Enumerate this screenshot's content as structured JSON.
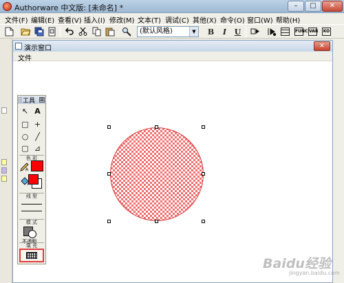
{
  "app": {
    "title": "Authorware 中文版: [未命名] *",
    "caption_buttons": {
      "minimize": "–",
      "maximize": "□",
      "close": "✕"
    }
  },
  "menubar": {
    "items": [
      {
        "label": "文件(F)"
      },
      {
        "label": "编辑(E)"
      },
      {
        "label": "查看(V)"
      },
      {
        "label": "插入(I)"
      },
      {
        "label": "修改(M)"
      },
      {
        "label": "文本(T)"
      },
      {
        "label": "调试(C)"
      },
      {
        "label": "其他(X)"
      },
      {
        "label": "命令(O)"
      },
      {
        "label": "窗口(W)"
      },
      {
        "label": "帮助(H)"
      }
    ]
  },
  "toolbar": {
    "style_select": {
      "value": "(默认风格)",
      "arrow": "▼"
    },
    "bold": "B",
    "italic": "I",
    "underline": "U",
    "icons": [
      "new-icon",
      "open-icon",
      "save-all-icon",
      "import-icon",
      "undo-icon",
      "cut-icon",
      "copy-icon",
      "paste-icon",
      "find-icon",
      "run-icon",
      "restart-icon",
      "control-panel-icon",
      "functions-icon",
      "variables-icon",
      "knowledge-objects-icon"
    ],
    "box_icons": {
      "functions": "FUNC",
      "variables": "VAR",
      "knowledge": "KO"
    }
  },
  "presentation_window": {
    "title": "演示窗口",
    "menu_file": "文件",
    "close": "✕"
  },
  "tools_palette": {
    "title": "工具",
    "close": "⊠",
    "tools": {
      "pointer": "↖",
      "text": "A",
      "rectangle": "□",
      "crosshair": "+",
      "ellipse": "○",
      "line": "╱",
      "rounded_rect": "▢",
      "polygon": "⊿"
    },
    "section_color": "色 彩",
    "section_line": "线 型",
    "section_mode": "模 式",
    "mode_value": "不透明",
    "section_fill": "填 充",
    "colors": {
      "stroke": "#ff0000",
      "fill_fore": "#ff0000",
      "fill_back": "#ffffff"
    }
  },
  "shape": {
    "type": "circle",
    "fill_color": "#ef6b6b",
    "stroke_color": "#d83a3a",
    "fill": "checkered"
  },
  "watermark": {
    "logo": "Baidu经验",
    "url": "jingyan.baidu.com"
  }
}
